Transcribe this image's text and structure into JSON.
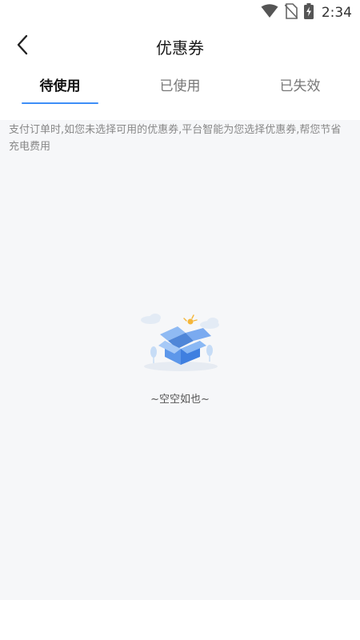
{
  "status_bar": {
    "time": "2:34",
    "icons": [
      "wifi-icon",
      "no-sim-icon",
      "battery-charging-icon"
    ]
  },
  "header": {
    "title": "优惠券",
    "back_icon": "chevron-left-icon"
  },
  "tabs": [
    {
      "label": "待使用",
      "active": true
    },
    {
      "label": "已使用",
      "active": false
    },
    {
      "label": "已失效",
      "active": false
    }
  ],
  "notice": "支付订单时,如您未选择可用的优惠券,平台智能为您选择优惠券,帮您节省充电费用",
  "empty_state": {
    "illustration": "empty-box-icon",
    "text": "~空空如也~"
  },
  "colors": {
    "accent": "#3e8ef7",
    "content_background": "#f6f7f9",
    "notice_text": "#888888"
  }
}
